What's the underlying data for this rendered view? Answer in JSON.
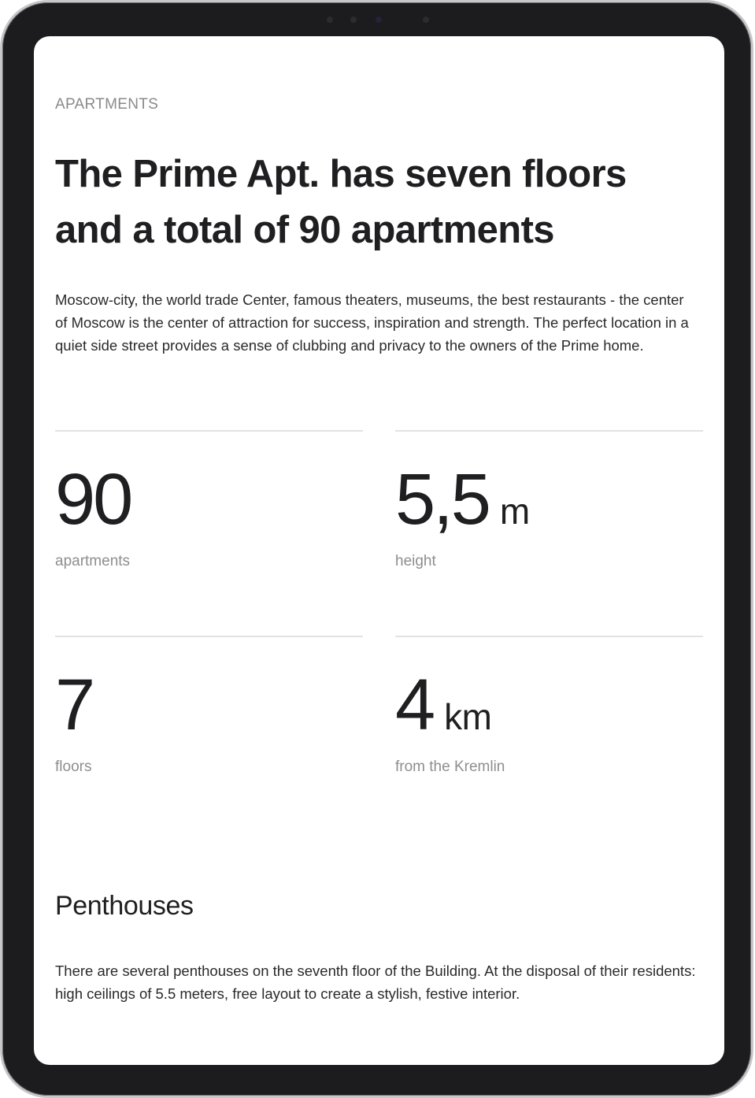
{
  "page": {
    "eyebrow": "APARTMENTS",
    "headline": "The Prime Apt. has seven floors and a total of 90 apartments",
    "intro": "Moscow-city, the world trade Center, famous theaters, museums, the best restaurants - the center of Moscow is the center of attraction for success, inspiration and strength. The perfect location in a quiet side street provides a sense of clubbing and privacy to the owners of the Prime home."
  },
  "stats": [
    {
      "value": "90",
      "unit": "",
      "label": "apartments"
    },
    {
      "value": "5,5",
      "unit": "m",
      "label": "height"
    },
    {
      "value": "7",
      "unit": "",
      "label": "floors"
    },
    {
      "value": "4",
      "unit": "km",
      "label": "from the Kremlin"
    }
  ],
  "penthouses": {
    "title": "Penthouses",
    "text": "There are several penthouses on the seventh floor of the Building. At the disposal of their residents: high ceilings of 5.5 meters, free layout to create a stylish, festive interior."
  },
  "device": {
    "frame_color": "#1c1c1e",
    "screen_color": "#ffffff"
  }
}
